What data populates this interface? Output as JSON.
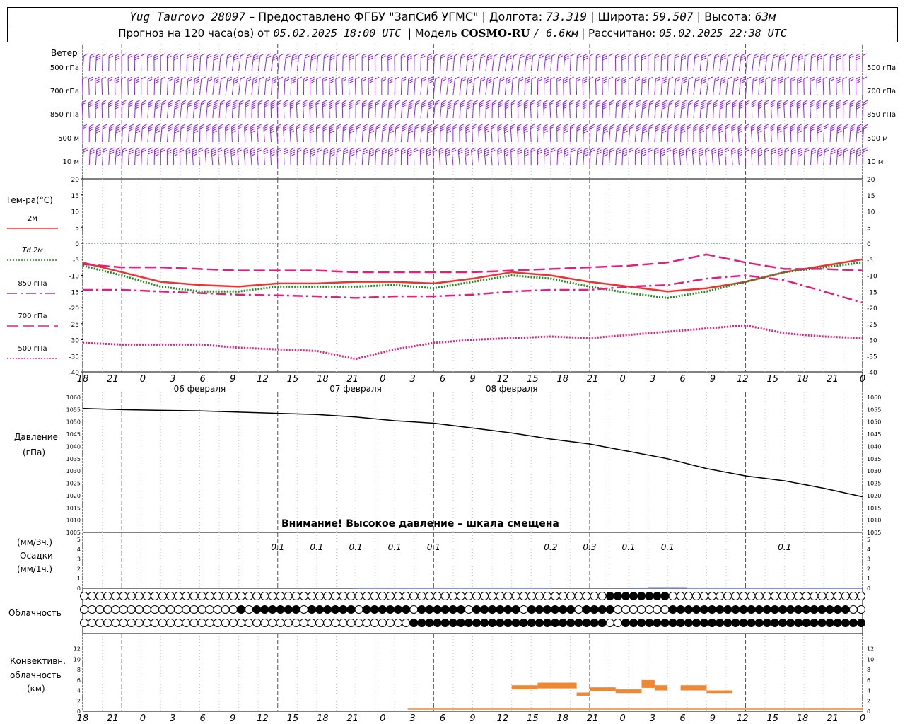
{
  "header": {
    "station": "Yug_Taurovo_28097",
    "provider_prefix": "– Предоставлено ФГБУ \"ЗапСиб УГМС\" | Долгота:",
    "longitude": "73.319",
    "lat_label": "| Широта:",
    "latitude": "59.507",
    "alt_label": "| Высота:",
    "altitude": "63м",
    "forecast_prefix": "Прогноз на 120 часа(ов) от",
    "forecast_start": "05.02.2025 18:00 UTC",
    "model_label": "| Модель",
    "model_name": "COSMO-RU",
    "model_res": "/ 6.6км",
    "calc_label": "| Рассчитано:",
    "calc_time": "05.02.2025 22:38 UTC"
  },
  "wind_panel": {
    "title": "Ветер",
    "levels": [
      "500 гПа",
      "700 гПа",
      "850 гПа",
      "500 м",
      "10 м"
    ],
    "barb_color": "#8b2be2"
  },
  "temp_panel": {
    "title": "Тем-ра(°С)",
    "legend": [
      {
        "label": "2м",
        "color": "#ee3333",
        "dash": "solid"
      },
      {
        "label": "Td 2м",
        "color": "#228822",
        "dash": "dotted"
      },
      {
        "label": "850 гПа",
        "color": "#e0207a",
        "dash": "dashdot"
      },
      {
        "label": "700 гПа",
        "color": "#e0207a",
        "dash": "longdash"
      },
      {
        "label": "500 гПа",
        "color": "#e0207a",
        "dash": "dotted"
      }
    ]
  },
  "time_axis": {
    "hour_ticks": [
      "18",
      "21",
      "0",
      "3",
      "6",
      "9",
      "12",
      "15",
      "18",
      "21",
      "0",
      "3",
      "6",
      "9",
      "12",
      "15",
      "18",
      "21",
      "0",
      "3",
      "6",
      "9",
      "12",
      "15",
      "18",
      "21",
      "0"
    ],
    "days": [
      "06 февраля",
      "07 февраля",
      "08 февраля"
    ]
  },
  "pressure_panel": {
    "title_line1": "Давление",
    "title_line2": "(гПа)",
    "warning": "Внимание! Высокое давление – шкала смещена"
  },
  "precip_panel": {
    "unit3": "(мм/3ч.)",
    "title": "Осадки",
    "unit1": "(мм/1ч.)",
    "labels": [
      {
        "hour_index": 15,
        "text": "0.1"
      },
      {
        "hour_index": 18,
        "text": "0.1"
      },
      {
        "hour_index": 21,
        "text": "0.1"
      },
      {
        "hour_index": 24,
        "text": "0.1"
      },
      {
        "hour_index": 27,
        "text": "0.1"
      },
      {
        "hour_index": 36,
        "text": "0.2"
      },
      {
        "hour_index": 39,
        "text": "0.3"
      },
      {
        "hour_index": 42,
        "text": "0.1"
      },
      {
        "hour_index": 45,
        "text": "0.1"
      },
      {
        "hour_index": 54,
        "text": "0.1"
      }
    ]
  },
  "cloud_panel": {
    "title": "Облачность"
  },
  "conv_panel": {
    "title_line1": "Конвективн.",
    "title_line2": "облачность",
    "title_line3": "(км)"
  },
  "chart_data": [
    {
      "type": "line",
      "title": "Тем-ра(°С)",
      "x_unit": "hours from 05.02.2025 18:00 UTC",
      "ylim": [
        -40,
        20
      ],
      "y_ticks": [
        20,
        15,
        10,
        5,
        0,
        -5,
        -10,
        -15,
        -20,
        -25,
        -30,
        -35,
        -40
      ],
      "x": [
        0,
        6,
        12,
        18,
        24,
        30,
        36,
        42,
        48,
        54,
        60,
        66,
        72,
        78,
        84,
        90,
        96,
        102,
        108,
        114,
        120
      ],
      "series": [
        {
          "name": "2м",
          "values": [
            -6,
            -9,
            -12,
            -13,
            -13.5,
            -12.5,
            -12.5,
            -12,
            -12,
            -12.5,
            -11,
            -9,
            -10,
            -12,
            -13.5,
            -15,
            -14,
            -12,
            -9,
            -7,
            -5
          ]
        },
        {
          "name": "Td 2м",
          "values": [
            -7,
            -10,
            -13.5,
            -15,
            -15,
            -13.5,
            -13.5,
            -13.5,
            -13,
            -14,
            -12,
            -10,
            -11,
            -13.5,
            -15.5,
            -17,
            -15,
            -12,
            -9,
            -7.5,
            -6
          ]
        },
        {
          "name": "850 гПа",
          "values": [
            -14.5,
            -14.5,
            -15,
            -15.5,
            -16,
            -16.2,
            -16.5,
            -17,
            -16.5,
            -16.5,
            -16,
            -15,
            -14.5,
            -14.5,
            -13.5,
            -13,
            -11,
            -10,
            -11.5,
            -15,
            -18.5
          ]
        },
        {
          "name": "700 гПа",
          "values": [
            -6.5,
            -7.5,
            -7.5,
            -8,
            -8.5,
            -8.5,
            -8.5,
            -9,
            -9,
            -9,
            -9,
            -8.5,
            -8,
            -7.5,
            -7,
            -6,
            -3.5,
            -6,
            -8,
            -8,
            -8.5
          ]
        },
        {
          "name": "500 гПа",
          "values": [
            -31,
            -31.5,
            -31.5,
            -31.5,
            -32.5,
            -33,
            -33.5,
            -36,
            -33,
            -31,
            -30,
            -29.5,
            -29,
            -29.5,
            -28.5,
            -27.5,
            -26.5,
            -25.5,
            -28,
            -29,
            -29.5
          ]
        }
      ]
    },
    {
      "type": "line",
      "title": "Давление (гПа)",
      "x_unit": "hours from 05.02.2025 18:00 UTC",
      "ylim": [
        1005,
        1060
      ],
      "y_ticks": [
        1060,
        1055,
        1050,
        1045,
        1040,
        1035,
        1030,
        1025,
        1020,
        1015,
        1010,
        1005
      ],
      "x": [
        0,
        6,
        12,
        18,
        24,
        30,
        36,
        42,
        48,
        54,
        60,
        66,
        72,
        78,
        84,
        90,
        96,
        102,
        108,
        114,
        120
      ],
      "values": [
        1055.5,
        1055,
        1054.7,
        1054.5,
        1054,
        1053.5,
        1053,
        1052,
        1050.5,
        1049.5,
        1047.5,
        1045.5,
        1043,
        1041,
        1038,
        1035,
        1031,
        1028,
        1026,
        1023,
        1019.5
      ]
    },
    {
      "type": "bar",
      "title": "Осадки",
      "x_unit": "hours from 05.02.2025 18:00 UTC",
      "ylim": [
        0,
        5
      ],
      "y_ticks": [
        5,
        4,
        3,
        2,
        1,
        0
      ],
      "x": [
        45,
        48,
        51,
        54,
        57,
        60,
        63,
        66,
        69,
        72,
        75,
        78,
        81,
        84,
        87,
        90,
        93,
        96,
        99,
        102,
        105,
        108,
        111,
        114,
        117,
        120
      ],
      "values": [
        0.05,
        0.05,
        0.03,
        0.03,
        0.05,
        0.05,
        0.05,
        0.05,
        0.05,
        0.03,
        0.0,
        0.0,
        0.0,
        0.0,
        0.07,
        0.1,
        0.1,
        0.05,
        0.05,
        0.03,
        0.03,
        0.03,
        0.03,
        0.03,
        0.05,
        0.05
      ]
    },
    {
      "type": "bar",
      "title": "Конвективн. облачность (км)",
      "x_unit": "hours from 05.02.2025 18:00 UTC",
      "ylim": [
        0,
        14
      ],
      "y_ticks": [
        12,
        10,
        8,
        6,
        4,
        2,
        0
      ],
      "bars": [
        {
          "x0": 33,
          "x1": 35,
          "y0": 4.2,
          "y1": 5
        },
        {
          "x0": 35,
          "x1": 38,
          "y0": 4.4,
          "y1": 5.5
        },
        {
          "x0": 38,
          "x1": 39,
          "y0": 3,
          "y1": 3.6
        },
        {
          "x0": 39,
          "x1": 41,
          "y0": 3.9,
          "y1": 4.6
        },
        {
          "x0": 41,
          "x1": 43,
          "y0": 3.5,
          "y1": 4.2
        },
        {
          "x0": 43,
          "x1": 44,
          "y0": 4.5,
          "y1": 6
        },
        {
          "x0": 44,
          "x1": 45,
          "y0": 4,
          "y1": 5
        },
        {
          "x0": 46,
          "x1": 48,
          "y0": 4,
          "y1": 5
        },
        {
          "x0": 48,
          "x1": 50,
          "y0": 3.5,
          "y1": 4
        },
        {
          "x0": 81,
          "x1": 83,
          "y0": 2.5,
          "y1": 3
        },
        {
          "x0": 84,
          "x1": 85,
          "y0": 2.2,
          "y1": 2.7
        },
        {
          "x0": 86,
          "x1": 87,
          "y0": 1.8,
          "y1": 2.3
        },
        {
          "x0": 89,
          "x1": 91,
          "y0": 2,
          "y1": 2.5
        },
        {
          "x0": 94,
          "x1": 95,
          "y0": 1.2,
          "y1": 1.6
        },
        {
          "x0": 111,
          "x1": 113,
          "y0": 4.5,
          "y1": 5
        }
      ]
    }
  ]
}
